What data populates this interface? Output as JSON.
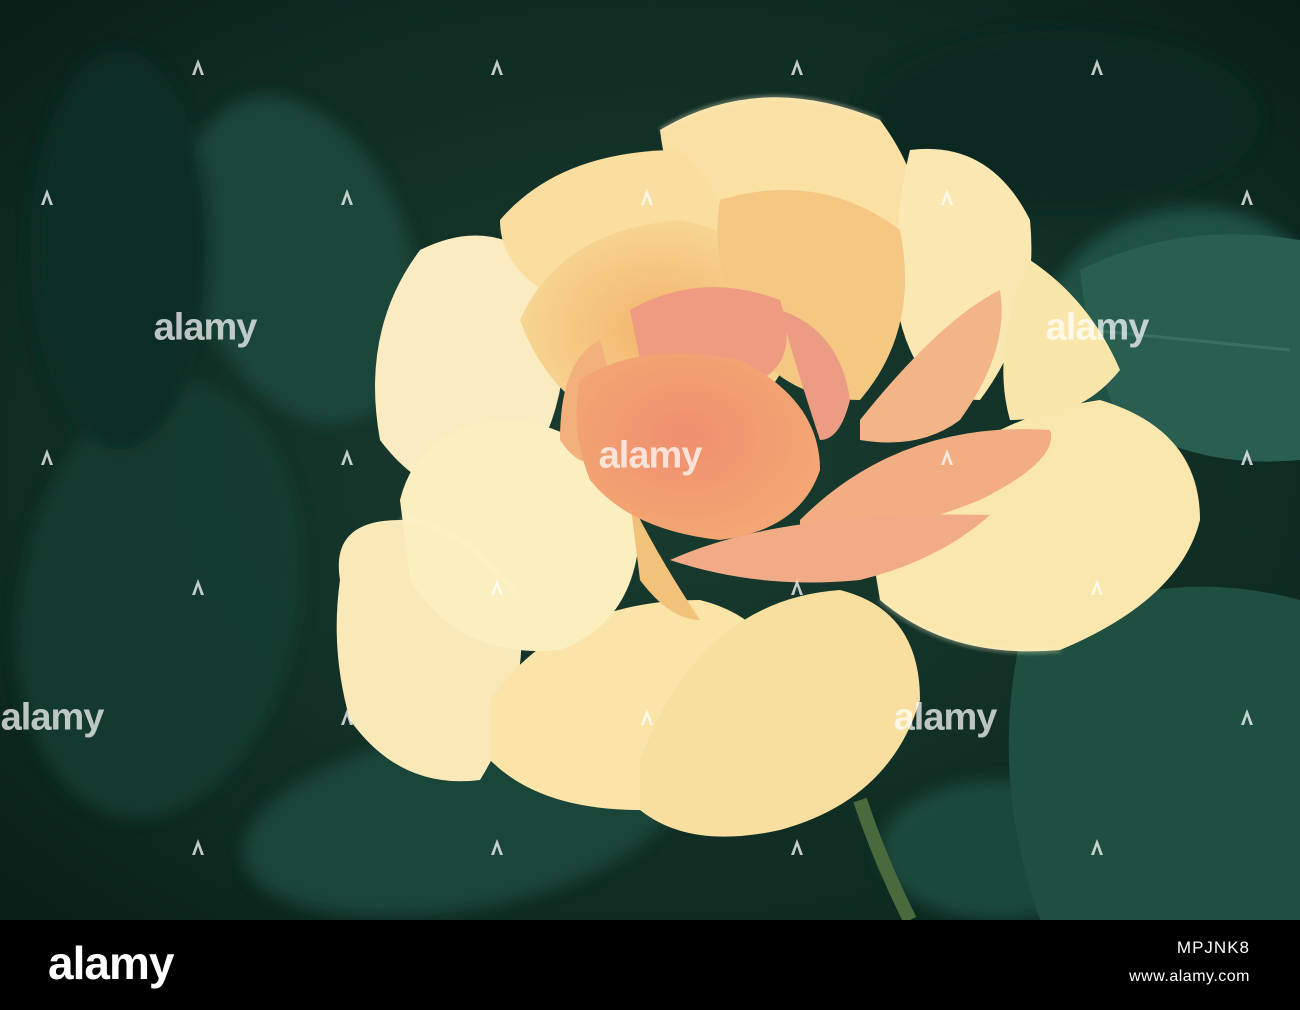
{
  "photo": {
    "subject": "rose",
    "colors": {
      "background": "#0f2a22",
      "leaf": "#1d4a3c",
      "petal": "#f7e2a0",
      "petal_shadow": "#f0c37a",
      "center": "#ef9a72"
    }
  },
  "watermark": {
    "text": "alamy",
    "icon": "alamy-a-icon"
  },
  "footer": {
    "logo": "alamy",
    "image_id": "MPJNK8",
    "url": "www.alamy.com"
  }
}
